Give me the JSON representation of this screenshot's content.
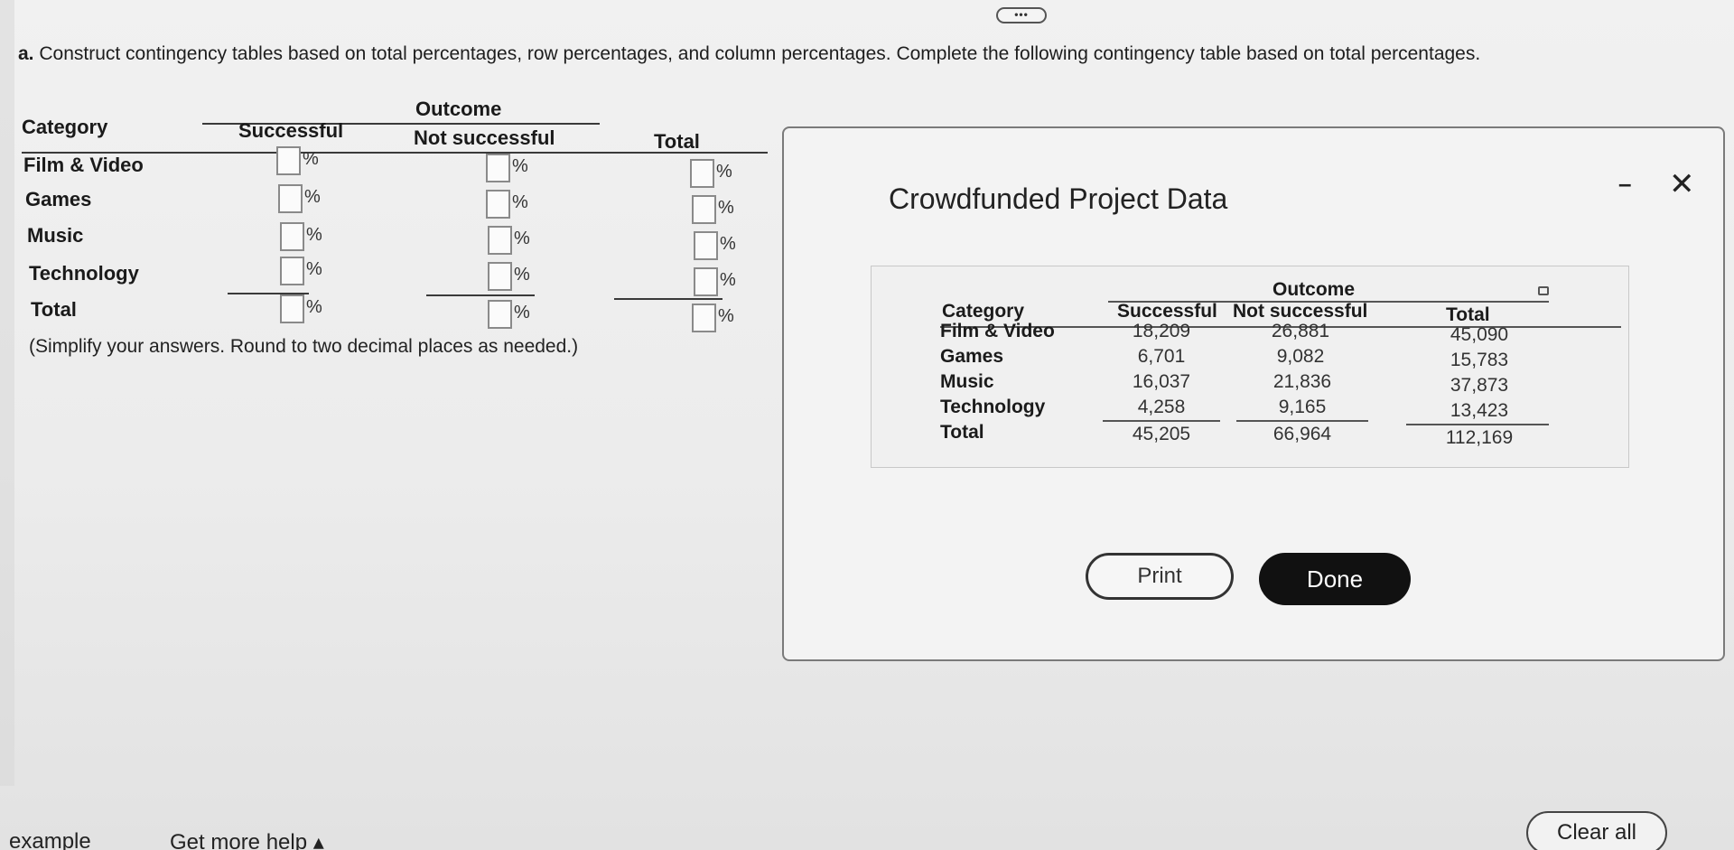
{
  "question": {
    "part": "a.",
    "text": "Construct contingency tables based on total percentages, row percentages, and column percentages. Complete the following contingency table based on total percentages."
  },
  "answer_table": {
    "group_header": "Outcome",
    "category_header": "Category",
    "columns": [
      "Successful",
      "Not successful",
      "Total"
    ],
    "rows": [
      "Film & Video",
      "Games",
      "Music",
      "Technology",
      "Total"
    ],
    "unit": "%",
    "note": "(Simplify your answers. Round to two decimal places as needed.)"
  },
  "ellipsis": "•••",
  "modal": {
    "title": "Crowdfunded Project Data",
    "minimize": "–",
    "close": "✕",
    "table": {
      "group_header": "Outcome",
      "category_header": "Category",
      "columns": [
        "Successful",
        "Not successful",
        "Total"
      ],
      "rows": [
        {
          "category": "Film & Video",
          "successful": "18,209",
          "not_successful": "26,881",
          "total": "45,090"
        },
        {
          "category": "Games",
          "successful": "6,701",
          "not_successful": "9,082",
          "total": "15,783"
        },
        {
          "category": "Music",
          "successful": "16,037",
          "not_successful": "21,836",
          "total": "37,873"
        },
        {
          "category": "Technology",
          "successful": "4,258",
          "not_successful": "9,165",
          "total": "13,423"
        },
        {
          "category": "Total",
          "successful": "45,205",
          "not_successful": "66,964",
          "total": "112,169"
        }
      ]
    },
    "print_label": "Print",
    "done_label": "Done"
  },
  "footer": {
    "example_label": "example",
    "help_label": "Get more help ▴",
    "clear_label": "Clear all"
  }
}
